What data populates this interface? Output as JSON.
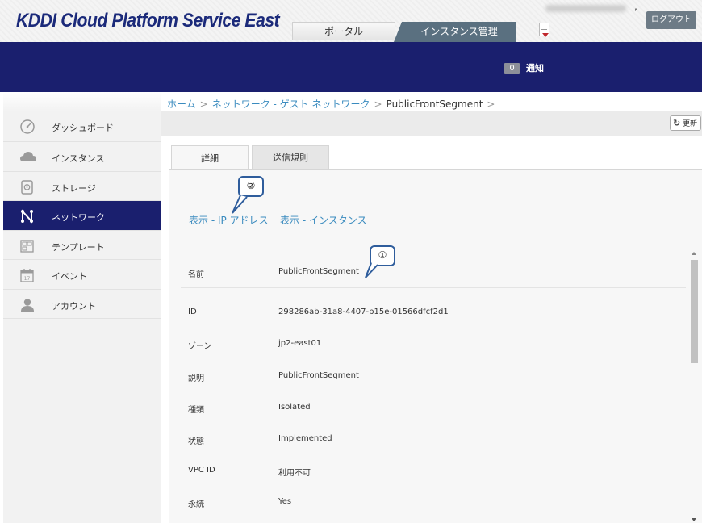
{
  "header": {
    "logo_text": "KDDI Cloud Platform Service East",
    "tabs": [
      {
        "label": "ポータル"
      },
      {
        "label": "インスタンス管理"
      }
    ],
    "user_suffix": ",",
    "logout_label": "ログアウト"
  },
  "notifications": {
    "count": "0",
    "label": "通知"
  },
  "sidebar": {
    "items": [
      {
        "label": "ダッシュボード",
        "icon": "dashboard-icon"
      },
      {
        "label": "インスタンス",
        "icon": "cloud-icon"
      },
      {
        "label": "ストレージ",
        "icon": "storage-icon"
      },
      {
        "label": "ネットワーク",
        "icon": "network-icon",
        "active": true
      },
      {
        "label": "テンプレート",
        "icon": "template-icon"
      },
      {
        "label": "イベント",
        "icon": "calendar-icon"
      },
      {
        "label": "アカウント",
        "icon": "user-icon"
      }
    ]
  },
  "breadcrumb": {
    "items": [
      "ホーム",
      "ネットワーク - ゲスト ネットワーク",
      "PublicFrontSegment"
    ],
    "sep": ">"
  },
  "toolbar": {
    "refresh_label": "更新"
  },
  "tabs": {
    "detail": "詳細",
    "egress": "送信規則"
  },
  "actions": {
    "view_ip": "表示 - IP アドレス",
    "view_instances": "表示 - インスタンス"
  },
  "callouts": {
    "one": "①",
    "two": "②"
  },
  "details": [
    {
      "label": "名前",
      "value": "PublicFrontSegment"
    },
    {
      "label": "ID",
      "value": "298286ab-31a8-4407-b15e-01566dfcf2d1"
    },
    {
      "label": "ゾーン",
      "value": "jp2-east01"
    },
    {
      "label": "説明",
      "value": "PublicFrontSegment"
    },
    {
      "label": "種類",
      "value": "Isolated"
    },
    {
      "label": "状態",
      "value": "Implemented"
    },
    {
      "label": "VPC ID",
      "value": "利用不可"
    },
    {
      "label": "永続",
      "value": "Yes"
    }
  ],
  "colors": {
    "navy": "#1a1f6e",
    "link": "#3a8bbf",
    "callout_border": "#2f5d9c"
  }
}
